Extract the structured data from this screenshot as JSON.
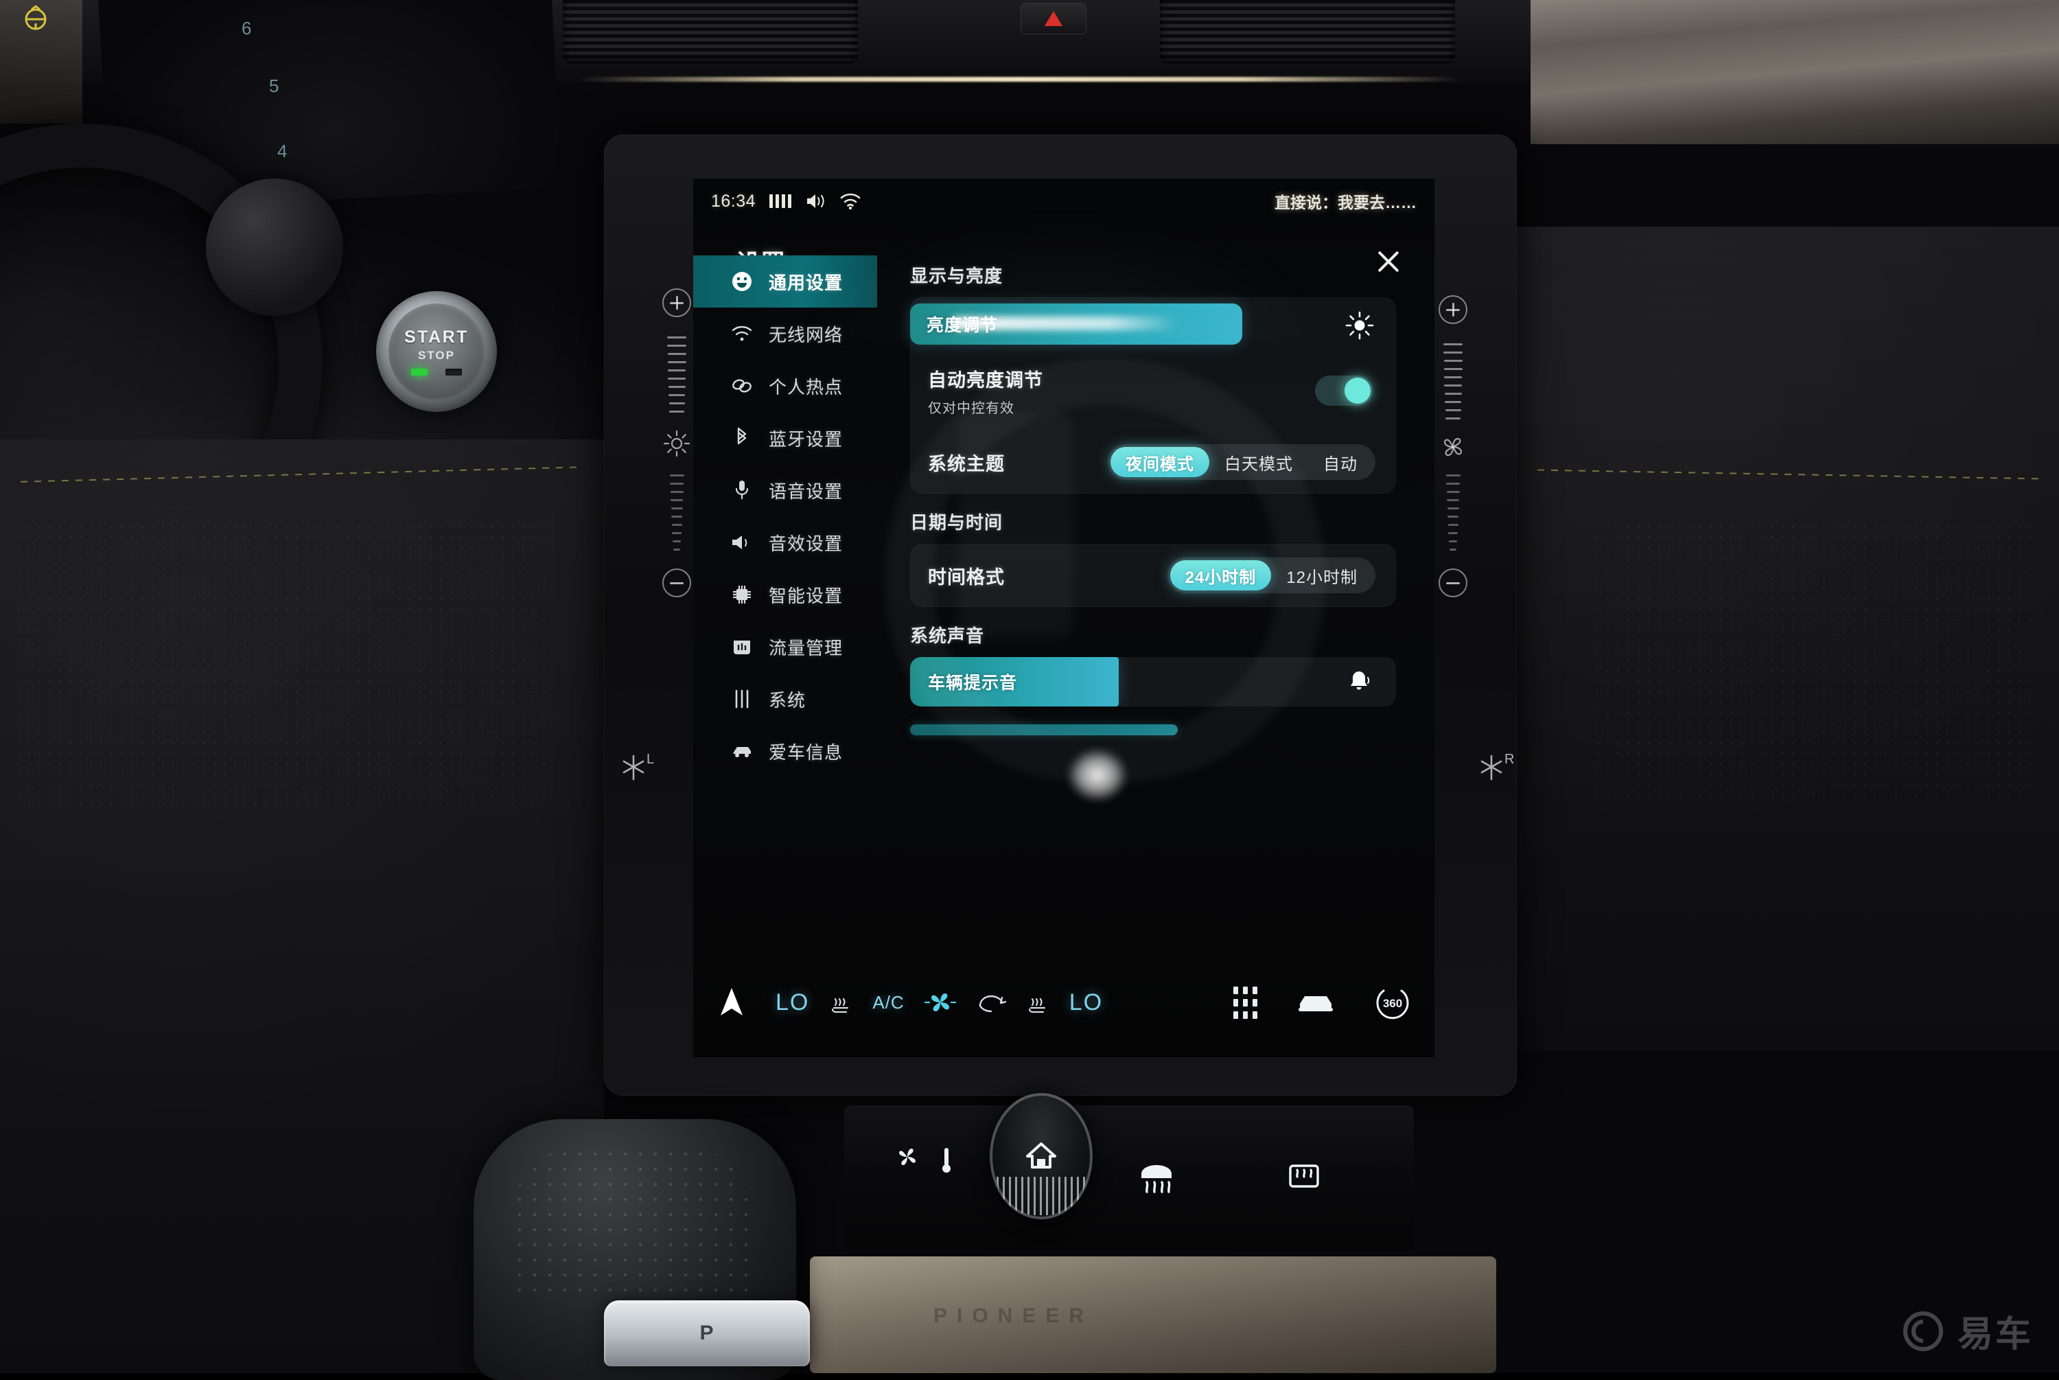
{
  "statusbar": {
    "time": "16:34",
    "signal_icon": "signal-bars-icon",
    "volume_icon": "volume-icon",
    "wifi_icon": "wifi-icon",
    "voice_hint": "直接说：我要去……"
  },
  "settings": {
    "title": "设置",
    "close_icon": "close-icon",
    "sidebar": [
      {
        "label": "通用设置",
        "icon": "smiley-face-icon",
        "active": true
      },
      {
        "label": "无线网络",
        "icon": "wifi-icon",
        "active": false
      },
      {
        "label": "个人热点",
        "icon": "hotspot-link-icon",
        "active": false
      },
      {
        "label": "蓝牙设置",
        "icon": "bluetooth-icon",
        "active": false
      },
      {
        "label": "语音设置",
        "icon": "microphone-icon",
        "active": false
      },
      {
        "label": "音效设置",
        "icon": "speaker-icon",
        "active": false
      },
      {
        "label": "智能设置",
        "icon": "chip-icon",
        "active": false
      },
      {
        "label": "流量管理",
        "icon": "data-usage-icon",
        "active": false
      },
      {
        "label": "系统",
        "icon": "sliders-icon",
        "active": false
      },
      {
        "label": "爱车信息",
        "icon": "car-icon",
        "active": false
      }
    ],
    "sections": {
      "display": {
        "title": "显示与亮度",
        "brightness": {
          "label": "亮度调节",
          "icon": "sun-icon",
          "value_percent": 60
        },
        "auto_brightness": {
          "label": "自动亮度调节",
          "sublabel": "仅对中控有效",
          "enabled": true
        },
        "theme": {
          "label": "系统主题",
          "options": [
            "夜间模式",
            "白天模式",
            "自动"
          ],
          "selected": "夜间模式"
        }
      },
      "datetime": {
        "title": "日期与时间",
        "time_format": {
          "label": "时间格式",
          "options": [
            "24小时制",
            "12小时制"
          ],
          "selected": "24小时制"
        }
      },
      "sound": {
        "title": "系统声音",
        "vehicle_prompt": {
          "label": "车辆提示音",
          "icon": "bell-icon",
          "value_percent": 42
        }
      }
    }
  },
  "climate_bar": {
    "nav_icon": "navigation-arrow-icon",
    "left_temp": "LO",
    "left_seat_icon": "seat-heat-icon",
    "ac_label": "A/C",
    "fan_icon": "fan-icon",
    "recirc_icon": "air-recirculation-icon",
    "right_seat_icon": "seat-heat-icon",
    "right_temp": "LO",
    "apps_icon": "app-grid-icon",
    "car_icon": "car-front-icon",
    "surround_icon": "360-view-icon",
    "surround_label": "360"
  },
  "bezel": {
    "left": {
      "plus": "plus-button",
      "icon": "sun-icon",
      "minus": "minus-button"
    },
    "right": {
      "plus": "plus-button",
      "icon": "fan-icon",
      "minus": "minus-button"
    },
    "seat_left": {
      "icon": "snowflake-icon",
      "label": "L"
    },
    "seat_right": {
      "icon": "snowflake-icon",
      "label": "R"
    }
  },
  "console": {
    "fan_icon": "fan-icon",
    "temp_icon": "thermometer-icon",
    "home_icon": "home-icon",
    "front_defrost_icon": "front-defrost-icon",
    "rear_defrost_icon": "rear-defrost-icon",
    "park_label": "P",
    "trim_text": "PIONEER"
  },
  "cluster": {
    "tach_labels": [
      "6",
      "5",
      "4"
    ],
    "warning_icon": "steering-warning-icon"
  },
  "startstop": {
    "line1": "START",
    "line2": "STOP",
    "led_state": "green"
  },
  "watermark": {
    "text": "易车",
    "logo_icon": "yiche-logo-icon"
  },
  "colors": {
    "accent_teal": "#0d7078",
    "accent_cyan": "#4fcfdc",
    "slider_cyan": "#3ab4cc",
    "toggle_on": "#6ee8dc",
    "status_text": "#e9e9df",
    "hazard_red": "#d8302a"
  }
}
